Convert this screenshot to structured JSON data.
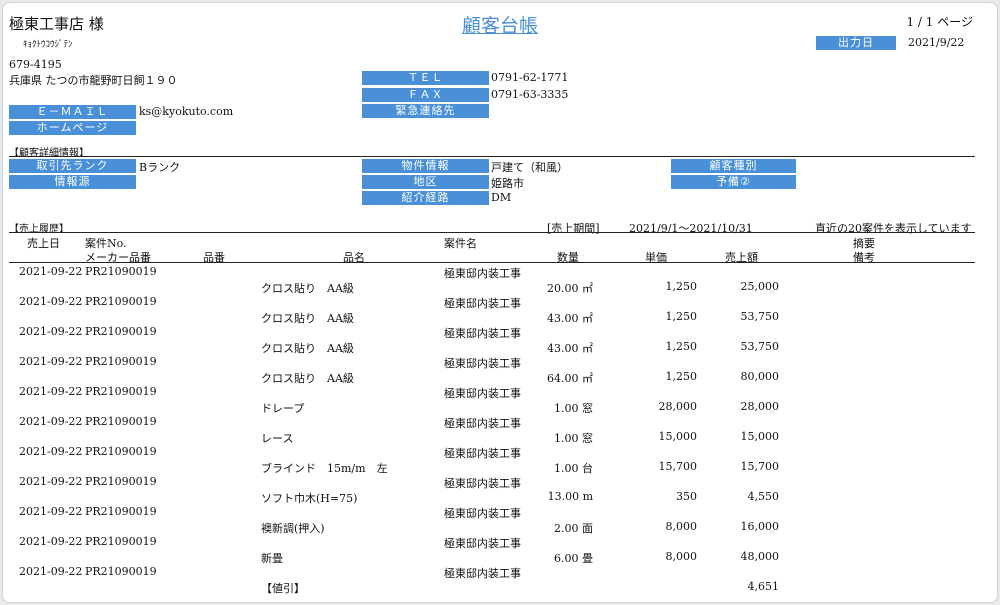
{
  "header": {
    "customer_name": "極東工事店 様",
    "customer_kana": "ｷｮｸﾄｳｺｳｼﾞﾃﾝ",
    "title": "顧客台帳",
    "page_info": "1 / 1 ページ",
    "output_date_label": "出力日",
    "output_date": "2021/9/22"
  },
  "contact": {
    "postal": "679-4195",
    "address": "兵庫県 たつの市龍野町日飼１９０",
    "tel_label": "ＴＥＬ",
    "tel": "0791-62-1771",
    "fax_label": "ＦＡＸ",
    "fax": "0791-63-3335",
    "emergency_label": "緊急連絡先",
    "emergency": "",
    "email_label": "Ｅ－ＭＡＩＬ",
    "email": "ks@kyokuto.com",
    "homepage_label": "ホームページ",
    "homepage": ""
  },
  "details": {
    "section_title": "【顧客詳細情報】",
    "rank_label": "取引先ランク",
    "rank": "Bランク",
    "source_label": "情報源",
    "source": "",
    "property_label": "物件情報",
    "property": "戸建て（和風）",
    "area_label": "地区",
    "area": "姫路市",
    "referral_label": "紹介経路",
    "referral": "DM",
    "type_label": "顧客種別",
    "type": "",
    "reserve_label": "予備②",
    "reserve": ""
  },
  "sales": {
    "section_title": "【売上履歴】",
    "period_label": "[売上期間]",
    "period": "2021/9/1～2021/10/31",
    "note": "直近の20案件を表示しています",
    "headers": {
      "date": "売上日",
      "case_no": "案件No.",
      "case_name": "案件名",
      "summary": "摘要",
      "maker_no": "メーカー品番",
      "product_no": "品番",
      "product_name": "品名",
      "qty": "数量",
      "unit_price": "単価",
      "amount": "売上額",
      "remarks": "備考"
    },
    "rows": [
      {
        "date": "2021-09-22",
        "case_no": "PR21090019",
        "case_name": "極東邸内装工事",
        "item": "クロス貼り　AA級",
        "qty": "20.00 ㎡",
        "price": "1,250",
        "amount": "25,000"
      },
      {
        "date": "2021-09-22",
        "case_no": "PR21090019",
        "case_name": "極東邸内装工事",
        "item": "クロス貼り　AA級",
        "qty": "43.00 ㎡",
        "price": "1,250",
        "amount": "53,750"
      },
      {
        "date": "2021-09-22",
        "case_no": "PR21090019",
        "case_name": "極東邸内装工事",
        "item": "クロス貼り　AA級",
        "qty": "43.00 ㎡",
        "price": "1,250",
        "amount": "53,750"
      },
      {
        "date": "2021-09-22",
        "case_no": "PR21090019",
        "case_name": "極東邸内装工事",
        "item": "クロス貼り　AA級",
        "qty": "64.00 ㎡",
        "price": "1,250",
        "amount": "80,000"
      },
      {
        "date": "2021-09-22",
        "case_no": "PR21090019",
        "case_name": "極東邸内装工事",
        "item": "ドレープ",
        "qty": "1.00 窓",
        "price": "28,000",
        "amount": "28,000"
      },
      {
        "date": "2021-09-22",
        "case_no": "PR21090019",
        "case_name": "極東邸内装工事",
        "item": "レース",
        "qty": "1.00 窓",
        "price": "15,000",
        "amount": "15,000"
      },
      {
        "date": "2021-09-22",
        "case_no": "PR21090019",
        "case_name": "極東邸内装工事",
        "item": "ブラインド　15m/m　左",
        "qty": "1.00 台",
        "price": "15,700",
        "amount": "15,700"
      },
      {
        "date": "2021-09-22",
        "case_no": "PR21090019",
        "case_name": "極東邸内装工事",
        "item": "ソフト巾木(H=75)",
        "qty": "13.00 m",
        "price": "350",
        "amount": "4,550"
      },
      {
        "date": "2021-09-22",
        "case_no": "PR21090019",
        "case_name": "極東邸内装工事",
        "item": "襖新調(押入)",
        "qty": "2.00 面",
        "price": "8,000",
        "amount": "16,000"
      },
      {
        "date": "2021-09-22",
        "case_no": "PR21090019",
        "case_name": "極東邸内装工事",
        "item": "新畳",
        "qty": "6.00 畳",
        "price": "8,000",
        "amount": "48,000"
      },
      {
        "date": "2021-09-22",
        "case_no": "PR21090019",
        "case_name": "極東邸内装工事",
        "item": "【値引】",
        "qty": "",
        "price": "",
        "amount": "4,651"
      }
    ]
  }
}
